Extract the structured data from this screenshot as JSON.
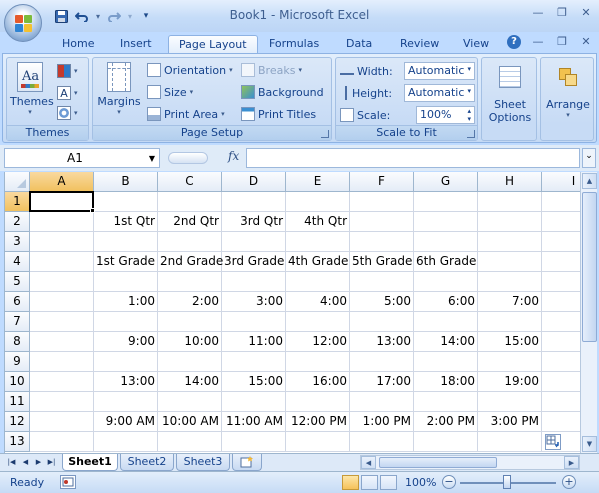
{
  "window": {
    "title": "Book1 - Microsoft Excel"
  },
  "quick_access": {
    "save_icon": "save-icon",
    "undo_icon": "undo-icon",
    "redo_icon": "redo-icon",
    "customize_icon": "customize-qat-icon"
  },
  "tabs": [
    {
      "label": "Home"
    },
    {
      "label": "Insert"
    },
    {
      "label": "Page Layout"
    },
    {
      "label": "Formulas"
    },
    {
      "label": "Data"
    },
    {
      "label": "Review"
    },
    {
      "label": "View"
    }
  ],
  "active_tab": "Page Layout",
  "ribbon": {
    "themes": {
      "themes_label": "Themes",
      "group_label": "Themes"
    },
    "page_setup": {
      "margins": "Margins",
      "orientation": "Orientation",
      "size": "Size",
      "print_area": "Print Area",
      "breaks": "Breaks",
      "background": "Background",
      "print_titles": "Print Titles",
      "group_label": "Page Setup"
    },
    "scale_to_fit": {
      "width_label": "Width:",
      "width_value": "Automatic",
      "height_label": "Height:",
      "height_value": "Automatic",
      "scale_label": "Scale:",
      "scale_value": "100%",
      "group_label": "Scale to Fit"
    },
    "sheet_options": {
      "line1": "Sheet",
      "line2": "Options"
    },
    "arrange": {
      "label": "Arrange"
    }
  },
  "formula_bar": {
    "name_box": "A1",
    "fx_label": "fx",
    "formula": ""
  },
  "grid": {
    "columns": [
      "A",
      "B",
      "C",
      "D",
      "E",
      "F",
      "G",
      "H",
      "I"
    ],
    "rows": [
      "1",
      "2",
      "3",
      "4",
      "5",
      "6",
      "7",
      "8",
      "9",
      "10",
      "11",
      "12",
      "13"
    ],
    "cells": {
      "B2": "1st Qtr",
      "C2": "2nd Qtr",
      "D2": "3rd Qtr",
      "E2": "4th Qtr",
      "B4": "1st Grade",
      "C4": "2nd Grade",
      "D4": "3rd Grade",
      "E4": "4th Grade",
      "F4": "5th Grade",
      "G4": "6th Grade",
      "B6": "1:00",
      "C6": "2:00",
      "D6": "3:00",
      "E6": "4:00",
      "F6": "5:00",
      "G6": "6:00",
      "H6": "7:00",
      "B8": "9:00",
      "C8": "10:00",
      "D8": "11:00",
      "E8": "12:00",
      "F8": "13:00",
      "G8": "14:00",
      "H8": "15:00",
      "B10": "13:00",
      "C10": "14:00",
      "D10": "15:00",
      "E10": "16:00",
      "F10": "17:00",
      "G10": "18:00",
      "H10": "19:00",
      "B12": "9:00 AM",
      "C12": "10:00 AM",
      "D12": "11:00 AM",
      "E12": "12:00 PM",
      "F12": "1:00 PM",
      "G12": "2:00 PM",
      "H12": "3:00 PM"
    },
    "active_cell": "A1"
  },
  "sheets": [
    {
      "label": "Sheet1"
    },
    {
      "label": "Sheet2"
    },
    {
      "label": "Sheet3"
    }
  ],
  "active_sheet": "Sheet1",
  "status": {
    "text": "Ready",
    "zoom": "100%"
  },
  "colors": {
    "ribbon_bg": "#bfdbff",
    "active_header": "#f1c15f",
    "gridline": "#d0d7e5"
  }
}
